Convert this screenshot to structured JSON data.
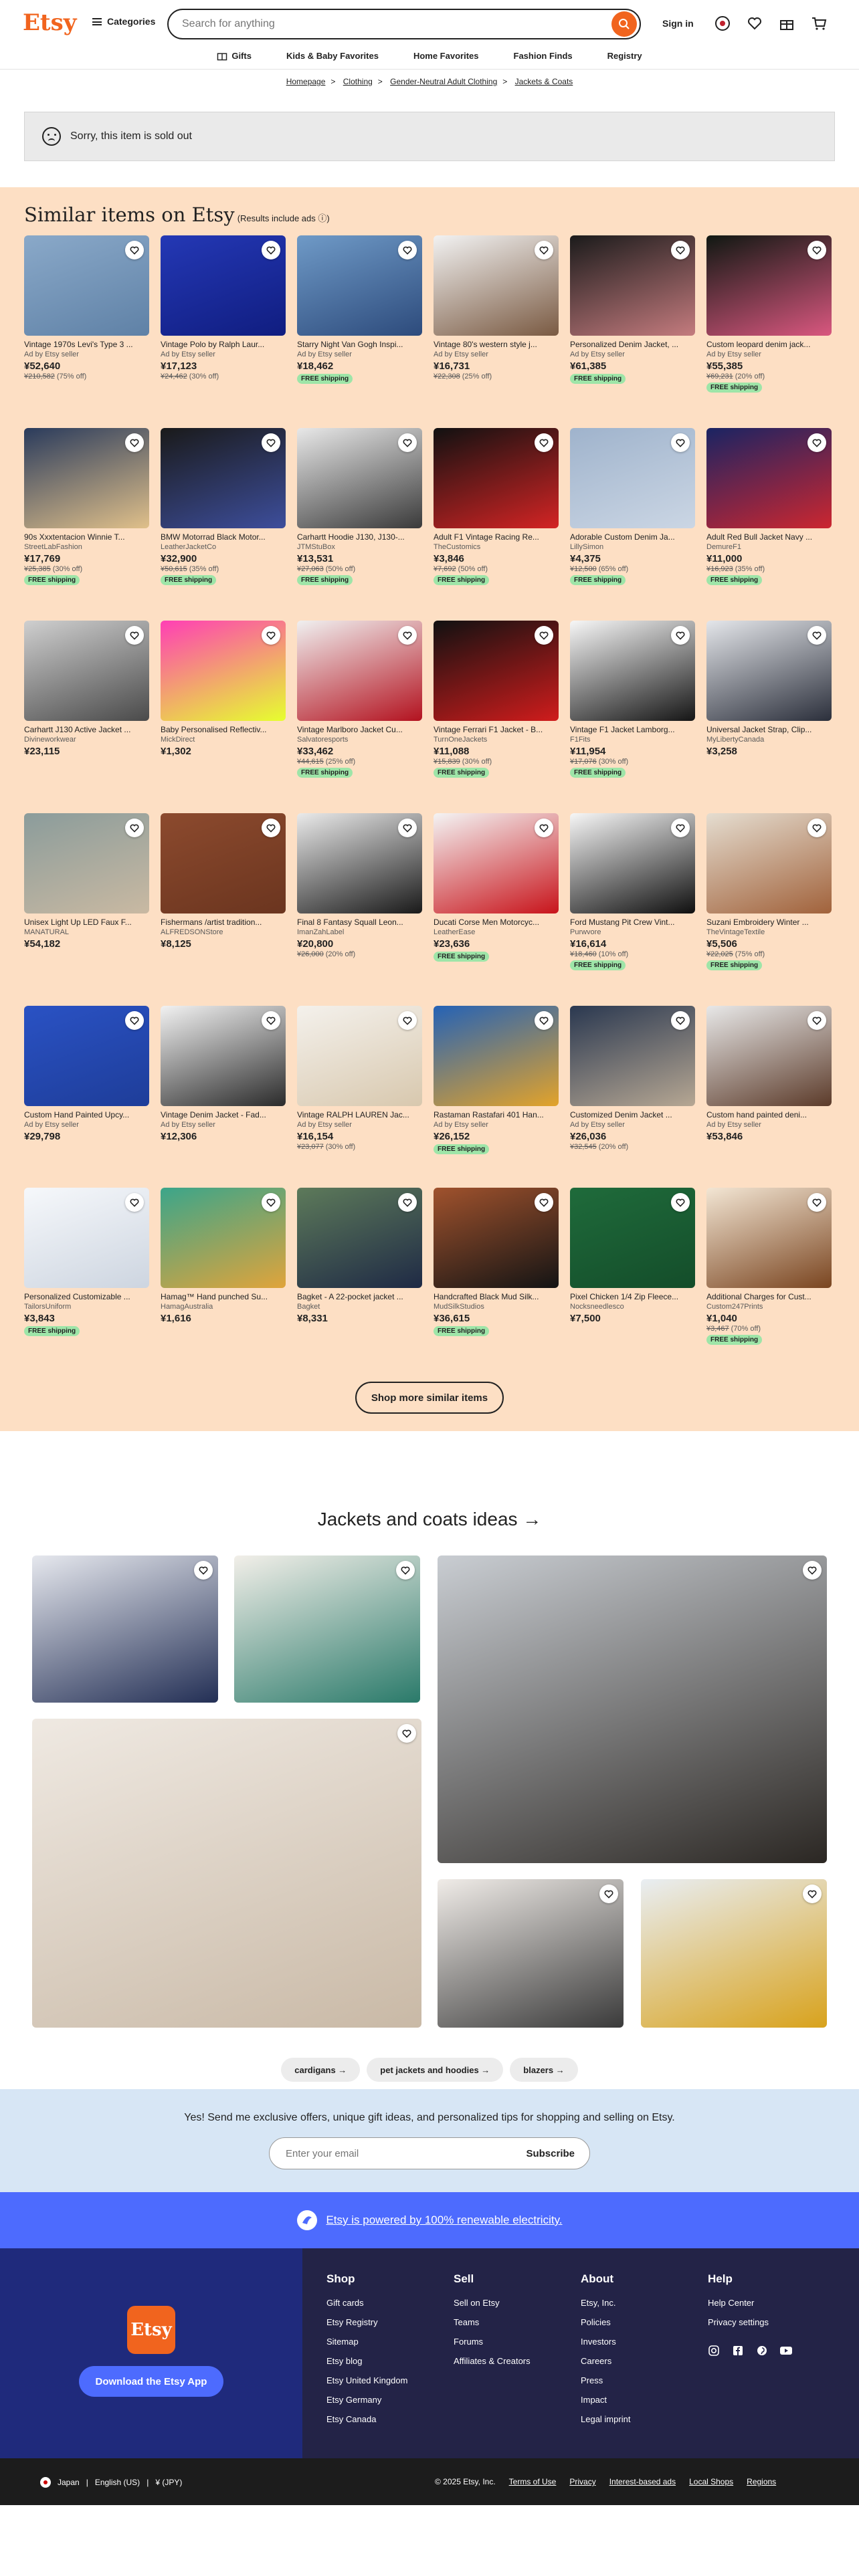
{
  "header": {
    "logo": "Etsy",
    "categories": "Categories",
    "search_placeholder": "Search for anything",
    "sign_in": "Sign in"
  },
  "subnav": [
    {
      "label": "Gifts",
      "icon": "gift-icon"
    },
    {
      "label": "Kids & Baby Favorites"
    },
    {
      "label": "Home Favorites"
    },
    {
      "label": "Fashion Finds"
    },
    {
      "label": "Registry"
    }
  ],
  "breadcrumb": [
    "Homepage",
    "Clothing",
    "Gender-Neutral Adult Clothing",
    "Jackets & Coats"
  ],
  "sold_out": "Sorry, this item is sold out",
  "similar": {
    "title": "Similar items on Etsy",
    "note": "(Results include ads ⓘ)",
    "button": "Shop more similar items"
  },
  "products": [
    {
      "title": "Vintage 1970s Levi's Type 3 ...",
      "seller": "Ad by Etsy seller",
      "price": "¥52,640",
      "orig": "¥210,582",
      "off": "(75% off)",
      "free": "",
      "colors": [
        "#8aa9c9",
        "#5f81a6"
      ]
    },
    {
      "title": "Vintage Polo by Ralph Laur...",
      "seller": "Ad by Etsy seller",
      "price": "¥17,123",
      "orig": "¥24,462",
      "off": "(30% off)",
      "free": "",
      "colors": [
        "#2438b5",
        "#101d80"
      ]
    },
    {
      "title": "Starry Night Van Gogh Inspi...",
      "seller": "Ad by Etsy seller",
      "price": "¥18,462",
      "orig": "",
      "off": "",
      "free": "FREE shipping",
      "colors": [
        "#6f9ac7",
        "#2d4b7c"
      ]
    },
    {
      "title": "Vintage 80's western style j...",
      "seller": "Ad by Etsy seller",
      "price": "¥16,731",
      "orig": "¥22,308",
      "off": "(25% off)",
      "free": "",
      "colors": [
        "#f2f2f2",
        "#7a5a42"
      ]
    },
    {
      "title": "Personalized Denim Jacket, ...",
      "seller": "Ad by Etsy seller",
      "price": "¥61,385",
      "orig": "",
      "off": "",
      "free": "FREE shipping",
      "colors": [
        "#1b1b1b",
        "#c47b7e"
      ]
    },
    {
      "title": "Custom leopard denim jack...",
      "seller": "Ad by Etsy seller",
      "price": "¥55,385",
      "orig": "¥69,231",
      "off": "(20% off)",
      "free": "FREE shipping",
      "colors": [
        "#101812",
        "#d9577f"
      ]
    },
    {
      "title": "90s Xxxtentacion Winnie T...",
      "seller": "StreetLabFashion",
      "price": "¥17,769",
      "orig": "¥25,385",
      "off": "(30% off)",
      "free": "FREE shipping",
      "colors": [
        "#2a3b5c",
        "#e0c08a"
      ]
    },
    {
      "title": "BMW Motorrad Black Motor...",
      "seller": "LeatherJacketCo",
      "price": "¥32,900",
      "orig": "¥50,615",
      "off": "(35% off)",
      "free": "FREE shipping",
      "colors": [
        "#1a1a1a",
        "#3d4e9c"
      ]
    },
    {
      "title": "Carhartt Hoodie J130, J130-...",
      "seller": "JTMStuBox",
      "price": "¥13,531",
      "orig": "¥27,063",
      "off": "(50% off)",
      "free": "FREE shipping",
      "colors": [
        "#e8e8e8",
        "#3a3a3a"
      ]
    },
    {
      "title": "Adult F1 Vintage Racing Re...",
      "seller": "TheCustomics",
      "price": "¥3,846",
      "orig": "¥7,692",
      "off": "(50% off)",
      "free": "FREE shipping",
      "colors": [
        "#111",
        "#d42424"
      ]
    },
    {
      "title": "Adorable Custom Denim Ja...",
      "seller": "LillySimon",
      "price": "¥4,375",
      "orig": "¥12,500",
      "off": "(65% off)",
      "free": "FREE shipping",
      "colors": [
        "#9fb3cc",
        "#cbd6e4"
      ]
    },
    {
      "title": "Adult Red Bull Jacket Navy ...",
      "seller": "DemureF1",
      "price": "¥11,000",
      "orig": "¥16,923",
      "off": "(35% off)",
      "free": "FREE shipping",
      "colors": [
        "#1a2463",
        "#cc2630"
      ]
    },
    {
      "title": "Carhartt J130 Active Jacket ...",
      "seller": "Divineworkwear",
      "price": "¥23,115",
      "orig": "",
      "off": "",
      "free": "",
      "colors": [
        "#cfcfcf",
        "#4a4a4a"
      ]
    },
    {
      "title": "Baby Personalised Reflectiv...",
      "seller": "MickDirect",
      "price": "¥1,302",
      "orig": "",
      "off": "",
      "free": "",
      "colors": [
        "#ff3fb5",
        "#e6ff2e"
      ]
    },
    {
      "title": "Vintage Marlboro Jacket Cu...",
      "seller": "Salvatoresports",
      "price": "¥33,462",
      "orig": "¥44,615",
      "off": "(25% off)",
      "free": "FREE shipping",
      "colors": [
        "#f0f0f0",
        "#b3121f"
      ]
    },
    {
      "title": "Vintage Ferrari F1 Jacket - B...",
      "seller": "TurnOneJackets",
      "price": "¥11,088",
      "orig": "¥15,839",
      "off": "(30% off)",
      "free": "FREE shipping",
      "colors": [
        "#111",
        "#d01c1c"
      ]
    },
    {
      "title": "Vintage F1 Jacket Lamborg...",
      "seller": "F1Fits",
      "price": "¥11,954",
      "orig": "¥17,076",
      "off": "(30% off)",
      "free": "FREE shipping",
      "colors": [
        "#f7f7f7",
        "#151515"
      ]
    },
    {
      "title": "Universal Jacket Strap, Clip...",
      "seller": "MyLibertyCanada",
      "price": "¥3,258",
      "orig": "",
      "off": "",
      "free": "",
      "colors": [
        "#e4e6ea",
        "#2b2f3b"
      ]
    },
    {
      "title": "Unisex Light Up LED Faux F...",
      "seller": "MANATURAL",
      "price": "¥54,182",
      "orig": "",
      "off": "",
      "free": "",
      "colors": [
        "#8b9c9b",
        "#c9b9a2"
      ]
    },
    {
      "title": "Fishermans /artist tradition...",
      "seller": "ALFREDSONStore",
      "price": "¥8,125",
      "orig": "",
      "off": "",
      "free": "",
      "colors": [
        "#8c4a2e",
        "#6b351f"
      ]
    },
    {
      "title": "Final 8 Fantasy Squall Leon...",
      "seller": "ImanZahLabel",
      "price": "¥20,800",
      "orig": "¥26,000",
      "off": "(20% off)",
      "free": "",
      "colors": [
        "#eaeaea",
        "#1a1a1a"
      ]
    },
    {
      "title": "Ducati Corse Men Motorcyc...",
      "seller": "LeatherEase",
      "price": "¥23,636",
      "orig": "",
      "off": "",
      "free": "FREE shipping",
      "colors": [
        "#f4f4f4",
        "#c8141b"
      ]
    },
    {
      "title": "Ford Mustang Pit Crew Vint...",
      "seller": "Purwvore",
      "price": "¥16,614",
      "orig": "¥18,460",
      "off": "(10% off)",
      "free": "FREE shipping",
      "colors": [
        "#f7f7f7",
        "#0f0f0f"
      ]
    },
    {
      "title": "Suzani Embroidery Winter ...",
      "seller": "TheVintageTextile",
      "price": "¥5,506",
      "orig": "¥22,025",
      "off": "(75% off)",
      "free": "FREE shipping",
      "colors": [
        "#e5ddd0",
        "#a1623b"
      ]
    },
    {
      "title": "Custom Hand Painted Upcy...",
      "seller": "Ad by Etsy seller",
      "price": "¥29,798",
      "orig": "",
      "off": "",
      "free": "",
      "colors": [
        "#2a52c4",
        "#1e3d99"
      ]
    },
    {
      "title": "Vintage Denim Jacket - Fad...",
      "seller": "Ad by Etsy seller",
      "price": "¥12,306",
      "orig": "",
      "off": "",
      "free": "",
      "colors": [
        "#f2f2f2",
        "#2b2b2b"
      ]
    },
    {
      "title": "Vintage RALPH LAUREN Jac...",
      "seller": "Ad by Etsy seller",
      "price": "¥16,154",
      "orig": "¥23,077",
      "off": "(30% off)",
      "free": "",
      "colors": [
        "#f4f1ec",
        "#d8c8ae"
      ]
    },
    {
      "title": "Rastaman Rastafari 401 Han...",
      "seller": "Ad by Etsy seller",
      "price": "¥26,152",
      "orig": "",
      "off": "",
      "free": "FREE shipping",
      "colors": [
        "#2462b6",
        "#e3a32a"
      ]
    },
    {
      "title": "Customized Denim Jacket ...",
      "seller": "Ad by Etsy seller",
      "price": "¥26,036",
      "orig": "¥32,545",
      "off": "(20% off)",
      "free": "",
      "colors": [
        "#2a3850",
        "#b6a793"
      ]
    },
    {
      "title": "Custom hand painted deni...",
      "seller": "Ad by Etsy seller",
      "price": "¥53,846",
      "orig": "",
      "off": "",
      "free": "",
      "colors": [
        "#e8e8e8",
        "#5c3b2a"
      ]
    },
    {
      "title": "Personalized Customizable ...",
      "seller": "TailorsUniform",
      "price": "¥3,843",
      "orig": "",
      "off": "",
      "free": "FREE shipping",
      "colors": [
        "#f6f8fb",
        "#cdd5e0"
      ]
    },
    {
      "title": "Hamag™ Hand punched Su...",
      "seller": "HamagAustralia",
      "price": "¥1,616",
      "orig": "",
      "off": "",
      "free": "",
      "colors": [
        "#3ba58a",
        "#e0a43b"
      ]
    },
    {
      "title": "Bagket - A 22-pocket jacket ...",
      "seller": "Bagket",
      "price": "¥8,331",
      "orig": "",
      "off": "",
      "free": "",
      "colors": [
        "#5d7a5a",
        "#1f2a45"
      ]
    },
    {
      "title": "Handcrafted Black Mud Silk...",
      "seller": "MudSilkStudios",
      "price": "¥36,615",
      "orig": "",
      "off": "",
      "free": "FREE shipping",
      "colors": [
        "#a0522d",
        "#141414"
      ]
    },
    {
      "title": "Pixel Chicken 1/4 Zip Fleece...",
      "seller": "Nocksneedlesco",
      "price": "¥7,500",
      "orig": "",
      "off": "",
      "free": "",
      "colors": [
        "#1f6b3b",
        "#144d2a"
      ]
    },
    {
      "title": "Additional Charges for Cust...",
      "seller": "Custom247Prints",
      "price": "¥1,040",
      "orig": "¥3,467",
      "off": "(70% off)",
      "free": "FREE shipping",
      "colors": [
        "#f3e6d4",
        "#7a4520"
      ]
    }
  ],
  "ideas": {
    "title": "Jackets and coats ideas →",
    "chips": [
      "cardigans →",
      "pet jackets and hoodies →",
      "blazers →"
    ]
  },
  "newsletter": {
    "text": "Yes! Send me exclusive offers, unique gift ideas, and personalized tips for shopping and selling on Etsy.",
    "placeholder": "Enter your email",
    "button": "Subscribe"
  },
  "renewable": "Etsy is powered by 100% renewable electricity.",
  "footer": {
    "app_button": "Download the Etsy App",
    "badge": "Etsy",
    "cols": [
      {
        "h": "Shop",
        "items": [
          "Gift cards",
          "Etsy Registry",
          "Sitemap",
          "Etsy blog",
          "Etsy United Kingdom",
          "Etsy Germany",
          "Etsy Canada"
        ]
      },
      {
        "h": "Sell",
        "items": [
          "Sell on Etsy",
          "Teams",
          "Forums",
          "Affiliates & Creators"
        ]
      },
      {
        "h": "About",
        "items": [
          "Etsy, Inc.",
          "Policies",
          "Investors",
          "Careers",
          "Press",
          "Impact",
          "Legal imprint"
        ]
      },
      {
        "h": "Help",
        "items": [
          "Help Center",
          "Privacy settings"
        ]
      }
    ]
  },
  "bottom": {
    "region": "Japan",
    "lang": "English (US)",
    "currency": "¥ (JPY)",
    "copyright": "© 2025 Etsy, Inc.",
    "links": [
      "Terms of Use",
      "Privacy",
      "Interest-based ads",
      "Local Shops",
      "Regions"
    ]
  }
}
